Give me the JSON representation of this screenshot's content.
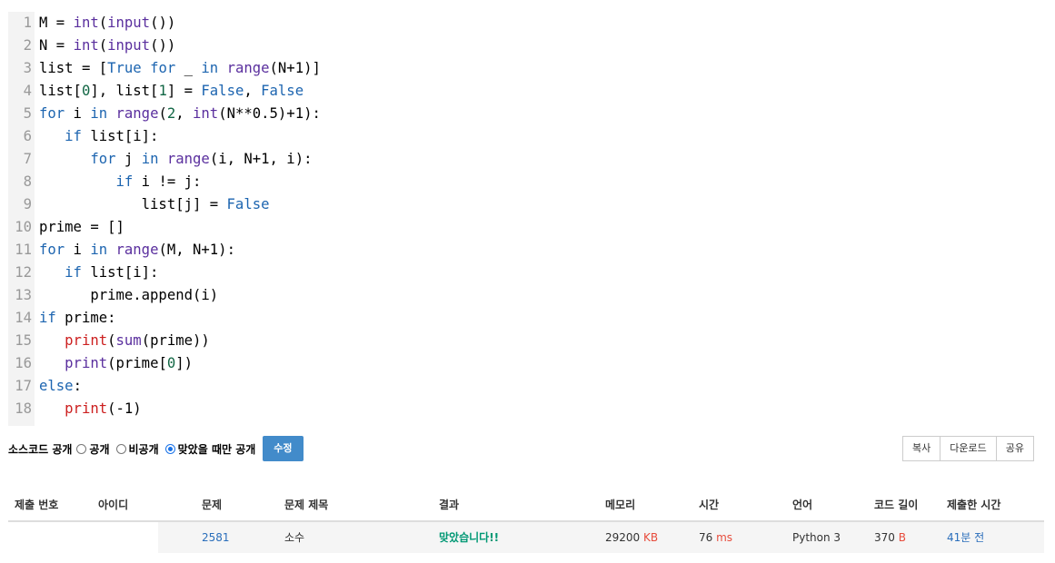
{
  "code": {
    "lines": [
      {
        "n": "1",
        "tokens": [
          [
            "tx",
            "M = "
          ],
          [
            "bi",
            "int"
          ],
          [
            "tx",
            "("
          ],
          [
            "bi",
            "input"
          ],
          [
            "tx",
            "())"
          ]
        ]
      },
      {
        "n": "2",
        "tokens": [
          [
            "tx",
            "N = "
          ],
          [
            "bi",
            "int"
          ],
          [
            "tx",
            "("
          ],
          [
            "bi",
            "input"
          ],
          [
            "tx",
            "())"
          ]
        ]
      },
      {
        "n": "3",
        "tokens": [
          [
            "tx",
            "list = ["
          ],
          [
            "kc",
            "True"
          ],
          [
            "tx",
            " "
          ],
          [
            "kw",
            "for"
          ],
          [
            "tx",
            " _ "
          ],
          [
            "kw",
            "in"
          ],
          [
            "tx",
            " "
          ],
          [
            "bi",
            "range"
          ],
          [
            "tx",
            "(N+1)]"
          ]
        ]
      },
      {
        "n": "4",
        "tokens": [
          [
            "tx",
            "list["
          ],
          [
            "nm",
            "0"
          ],
          [
            "tx",
            "], list["
          ],
          [
            "nm",
            "1"
          ],
          [
            "tx",
            "] = "
          ],
          [
            "kc",
            "False"
          ],
          [
            "tx",
            ", "
          ],
          [
            "kc",
            "False"
          ]
        ]
      },
      {
        "n": "5",
        "tokens": [
          [
            "kw",
            "for"
          ],
          [
            "tx",
            " i "
          ],
          [
            "kw",
            "in"
          ],
          [
            "tx",
            " "
          ],
          [
            "bi",
            "range"
          ],
          [
            "tx",
            "("
          ],
          [
            "nm",
            "2"
          ],
          [
            "tx",
            ", "
          ],
          [
            "bi",
            "int"
          ],
          [
            "tx",
            "(N**0.5)+1):"
          ]
        ]
      },
      {
        "n": "6",
        "tokens": [
          [
            "tx",
            "   "
          ],
          [
            "kw",
            "if"
          ],
          [
            "tx",
            " list[i]:"
          ]
        ]
      },
      {
        "n": "7",
        "tokens": [
          [
            "tx",
            "      "
          ],
          [
            "kw",
            "for"
          ],
          [
            "tx",
            " j "
          ],
          [
            "kw",
            "in"
          ],
          [
            "tx",
            " "
          ],
          [
            "bi",
            "range"
          ],
          [
            "tx",
            "(i, N+1, i):"
          ]
        ]
      },
      {
        "n": "8",
        "tokens": [
          [
            "tx",
            "         "
          ],
          [
            "kw",
            "if"
          ],
          [
            "tx",
            " i != j:"
          ]
        ]
      },
      {
        "n": "9",
        "tokens": [
          [
            "tx",
            "            list[j] = "
          ],
          [
            "kc",
            "False"
          ]
        ]
      },
      {
        "n": "10",
        "tokens": [
          [
            "tx",
            "prime = []"
          ]
        ]
      },
      {
        "n": "11",
        "tokens": [
          [
            "kw",
            "for"
          ],
          [
            "tx",
            " i "
          ],
          [
            "kw",
            "in"
          ],
          [
            "tx",
            " "
          ],
          [
            "bi",
            "range"
          ],
          [
            "tx",
            "(M, N+1):"
          ]
        ]
      },
      {
        "n": "12",
        "tokens": [
          [
            "tx",
            "   "
          ],
          [
            "kw",
            "if"
          ],
          [
            "tx",
            " list[i]:"
          ]
        ]
      },
      {
        "n": "13",
        "tokens": [
          [
            "tx",
            "      prime.append(i)"
          ]
        ]
      },
      {
        "n": "14",
        "tokens": [
          [
            "kw",
            "if"
          ],
          [
            "tx",
            " prime:"
          ]
        ]
      },
      {
        "n": "15",
        "tokens": [
          [
            "tx",
            "   "
          ],
          [
            "pr",
            "print"
          ],
          [
            "tx",
            "("
          ],
          [
            "bi",
            "sum"
          ],
          [
            "tx",
            "(prime))"
          ]
        ]
      },
      {
        "n": "16",
        "tokens": [
          [
            "tx",
            "   "
          ],
          [
            "bi",
            "print"
          ],
          [
            "tx",
            "(prime["
          ],
          [
            "nm",
            "0"
          ],
          [
            "tx",
            "])"
          ]
        ]
      },
      {
        "n": "17",
        "tokens": [
          [
            "kw",
            "else"
          ],
          [
            "tx",
            ":"
          ]
        ]
      },
      {
        "n": "18",
        "tokens": [
          [
            "tx",
            "   "
          ],
          [
            "pr",
            "print"
          ],
          [
            "tx",
            "(-1)"
          ]
        ]
      }
    ]
  },
  "visibility": {
    "label": "소스코드 공개",
    "options": [
      {
        "label": "공개",
        "selected": false
      },
      {
        "label": "비공개",
        "selected": false
      },
      {
        "label": "맞았을 때만 공개",
        "selected": true
      }
    ],
    "edit_button": "수정"
  },
  "actions": {
    "copy": "복사",
    "download": "다운로드",
    "share": "공유"
  },
  "table": {
    "headers": {
      "submission_id": "제출 번호",
      "user_id": "아이디",
      "problem": "문제",
      "problem_title": "문제 제목",
      "result": "결과",
      "memory": "메모리",
      "time": "시간",
      "language": "언어",
      "code_length": "코드 길이",
      "submitted_at": "제출한 시간"
    },
    "row": {
      "submission_id": "",
      "user_id": "",
      "problem": "2581",
      "problem_title": "소수",
      "result": "맞았습니다!!",
      "memory_value": "29200",
      "memory_unit": "KB",
      "time_value": "76",
      "time_unit": "ms",
      "language": "Python 3",
      "code_length_value": "370",
      "code_length_unit": "B",
      "submitted_at": "41분 전"
    }
  }
}
